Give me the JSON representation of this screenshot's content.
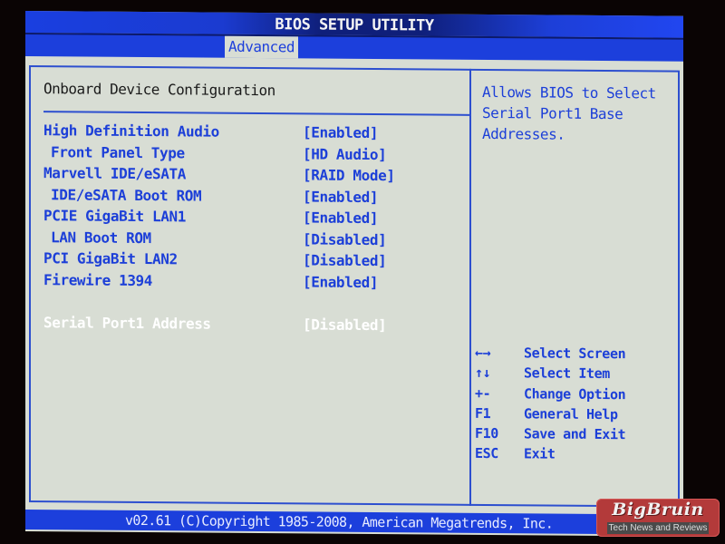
{
  "window": {
    "title": "BIOS SETUP UTILITY"
  },
  "tabs": [
    {
      "label": "Advanced",
      "active": true
    }
  ],
  "section": {
    "title": "Onboard Device Configuration"
  },
  "settings": [
    {
      "label": "High Definition Audio",
      "value": "[Enabled]",
      "indent": false,
      "selected": false
    },
    {
      "label": "Front Panel Type",
      "value": "[HD Audio]",
      "indent": true,
      "selected": false
    },
    {
      "label": "Marvell IDE/eSATA",
      "value": "[RAID Mode]",
      "indent": false,
      "selected": false
    },
    {
      "label": "IDE/eSATA Boot ROM",
      "value": "[Enabled]",
      "indent": true,
      "selected": false
    },
    {
      "label": "PCIE GigaBit LAN1",
      "value": "[Enabled]",
      "indent": false,
      "selected": false
    },
    {
      "label": "LAN Boot ROM",
      "value": "[Disabled]",
      "indent": true,
      "selected": false
    },
    {
      "label": "PCI GigaBit LAN2",
      "value": "[Disabled]",
      "indent": false,
      "selected": false
    },
    {
      "label": "Firewire 1394",
      "value": "[Enabled]",
      "indent": false,
      "selected": false
    },
    {
      "label": "Serial Port1 Address",
      "value": "[Disabled]",
      "indent": false,
      "selected": true
    }
  ],
  "help": {
    "text": "Allows BIOS to Select Serial Port1 Base Addresses.",
    "keys": [
      {
        "key": "←→",
        "action": "Select Screen",
        "icon": "left-right-arrows-icon"
      },
      {
        "key": "↑↓",
        "action": "Select Item",
        "icon": "up-down-arrows-icon"
      },
      {
        "key": "+-",
        "action": "Change Option",
        "icon": "plus-minus-icon"
      },
      {
        "key": "F1",
        "action": "General Help"
      },
      {
        "key": "F10",
        "action": "Save and Exit"
      },
      {
        "key": "ESC",
        "action": "Exit"
      }
    ]
  },
  "footer": {
    "copyright": "v02.61 (C)Copyright 1985-2008, American Megatrends, Inc."
  },
  "watermark": {
    "brand": "BigBruin",
    "tagline": "Tech News and Reviews"
  },
  "colors": {
    "bios_blue": "#1c3fdc",
    "panel_bg": "#d8ddd4",
    "selected_text": "#ffffff",
    "watermark_red": "#b33a3a"
  }
}
